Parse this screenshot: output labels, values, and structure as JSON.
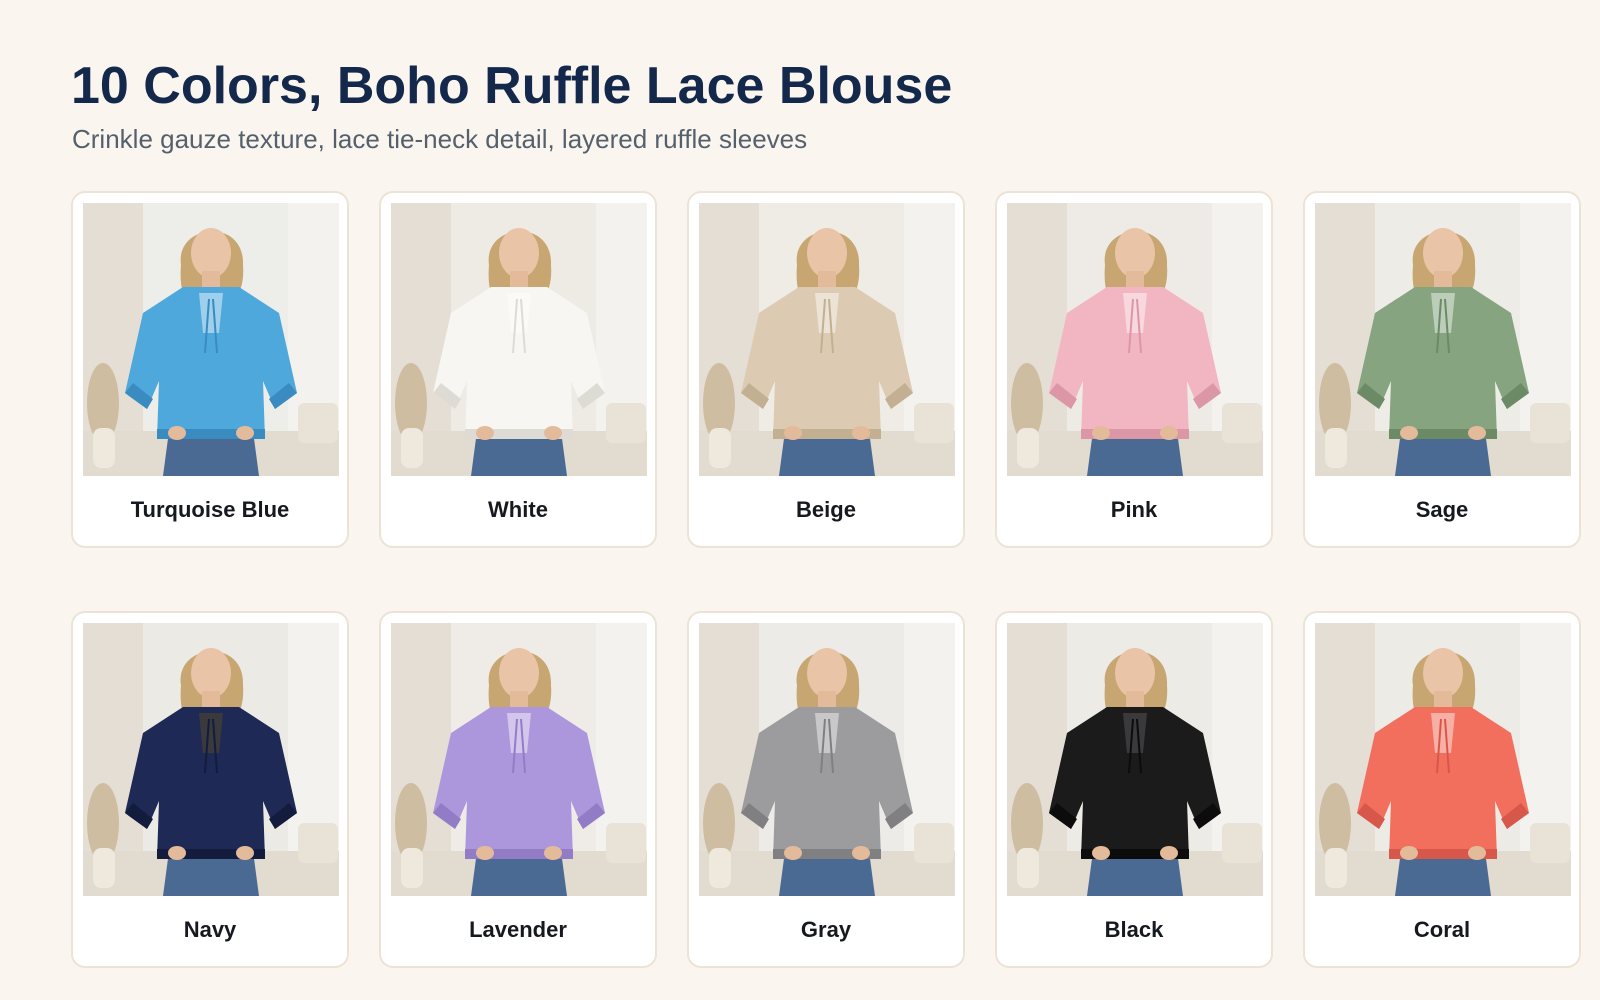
{
  "header": {
    "title": "10 Colors, Boho Ruffle Lace Blouse",
    "subtitle": "Crinkle gauze texture, lace tie-neck detail, layered ruffle sleeves"
  },
  "products": [
    {
      "label": "Turquoise Blue",
      "color": "#4fa8dc",
      "shade": "#3a8bc0",
      "background": "#ededea"
    },
    {
      "label": "White",
      "color": "#f7f6f3",
      "shade": "#dedbd5",
      "background": "#eeeae4"
    },
    {
      "label": "Beige",
      "color": "#dccbb2",
      "shade": "#c3b093",
      "background": "#efebe5"
    },
    {
      "label": "Pink",
      "color": "#f2b6c3",
      "shade": "#dc97a6",
      "background": "#eeebe6"
    },
    {
      "label": "Sage",
      "color": "#86a480",
      "shade": "#6c8a66",
      "background": "#eeece7"
    },
    {
      "label": "Navy",
      "color": "#1e2a55",
      "shade": "#131c3d",
      "background": "#eceae5"
    },
    {
      "label": "Lavender",
      "color": "#ad97dc",
      "shade": "#937cc6",
      "background": "#efece8"
    },
    {
      "label": "Gray",
      "color": "#9c9c9e",
      "shade": "#808083",
      "background": "#ecebe8"
    },
    {
      "label": "Black",
      "color": "#1b1b1c",
      "shade": "#0c0c0d",
      "background": "#ecebe6"
    },
    {
      "label": "Coral",
      "color": "#f26f5e",
      "shade": "#d7584a",
      "background": "#edebe6"
    }
  ]
}
